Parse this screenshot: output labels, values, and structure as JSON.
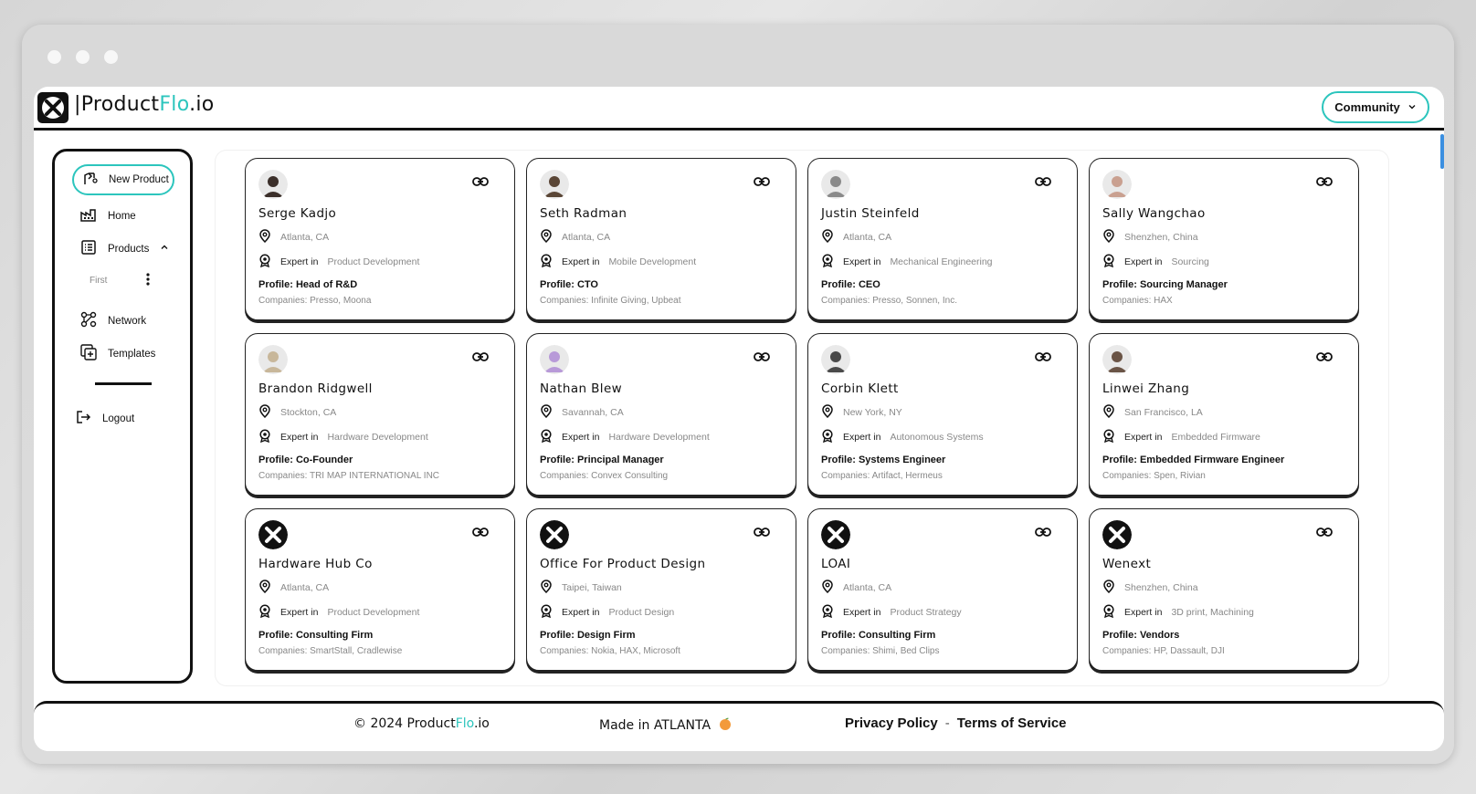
{
  "brand": {
    "prefix": "|Product",
    "accent": "Flo",
    "suffix": ".io"
  },
  "header": {
    "community_label": "Community"
  },
  "sidebar": {
    "new_product_label": "New Product",
    "items": [
      {
        "label": "Home",
        "icon": "factory-icon"
      },
      {
        "label": "Products",
        "icon": "list-icon"
      },
      {
        "label": "Network",
        "icon": "network-icon"
      },
      {
        "label": "Templates",
        "icon": "templates-icon"
      }
    ],
    "products_sub": "First",
    "logout_label": "Logout"
  },
  "cards": [
    {
      "name": "Serge Kadjo",
      "location": "Atlanta, CA",
      "expert_prefix": "Expert in",
      "expertise": "Product Development",
      "profile": "Profile: Head of R&D",
      "companies": "Companies: Presso, Moona",
      "avatar": "person",
      "avatar_color": "#3b2f2a"
    },
    {
      "name": "Seth Radman",
      "location": "Atlanta, CA",
      "expert_prefix": "Expert in",
      "expertise": "Mobile Development",
      "profile": "Profile: CTO",
      "companies": "Companies: Infinite Giving, Upbeat",
      "avatar": "person",
      "avatar_color": "#5a4636"
    },
    {
      "name": "Justin Steinfeld",
      "location": "Atlanta, CA",
      "expert_prefix": "Expert in",
      "expertise": "Mechanical Engineering",
      "profile": "Profile: CEO",
      "companies": "Companies: Presso, Sonnen, Inc.",
      "avatar": "person",
      "avatar_color": "#8a8a8a"
    },
    {
      "name": "Sally Wangchao",
      "location": "Shenzhen, China",
      "expert_prefix": "Expert in",
      "expertise": "Sourcing",
      "profile": "Profile: Sourcing Manager",
      "companies": "Companies: HAX",
      "avatar": "person",
      "avatar_color": "#c9a090"
    },
    {
      "name": "Brandon Ridgwell",
      "location": "Stockton, CA",
      "expert_prefix": "Expert in",
      "expertise": "Hardware Development",
      "profile": "Profile: Co-Founder",
      "companies": "Companies: TRI MAP INTERNATIONAL INC",
      "avatar": "person",
      "avatar_color": "#c8b79a"
    },
    {
      "name": "Nathan Blew",
      "location": "Savannah, CA",
      "expert_prefix": "Expert in",
      "expertise": "Hardware Development",
      "profile": "Profile: Principal Manager",
      "companies": "Companies: Convex Consulting",
      "avatar": "person",
      "avatar_color": "#b89ad8"
    },
    {
      "name": "Corbin Klett",
      "location": "New York, NY",
      "expert_prefix": "Expert in",
      "expertise": "Autonomous Systems",
      "profile": "Profile: Systems Engineer",
      "companies": "Companies: Artifact, Hermeus",
      "avatar": "person",
      "avatar_color": "#4a4a4a"
    },
    {
      "name": "Linwei Zhang",
      "location": "San Francisco, LA",
      "expert_prefix": "Expert in",
      "expertise": "Embedded Firmware",
      "profile": "Profile: Embedded Firmware Engineer",
      "companies": "Companies: Spen, Rivian",
      "avatar": "person",
      "avatar_color": "#6a5446"
    },
    {
      "name": "Hardware Hub Co",
      "location": "Atlanta, CA",
      "expert_prefix": "Expert in",
      "expertise": "Product Development",
      "profile": "Profile: Consulting Firm",
      "companies": "Companies: SmartStall, Cradlewise",
      "avatar": "logo",
      "avatar_color": "#111111"
    },
    {
      "name": "Office For Product Design",
      "location": "Taipei, Taiwan",
      "expert_prefix": "Expert in",
      "expertise": "Product Design",
      "profile": "Profile: Design Firm",
      "companies": "Companies: Nokia, HAX, Microsoft",
      "avatar": "logo",
      "avatar_color": "#111111"
    },
    {
      "name": "LOAI",
      "location": "Atlanta, CA",
      "expert_prefix": "Expert in",
      "expertise": "Product Strategy",
      "profile": "Profile: Consulting Firm",
      "companies": "Companies: Shimi, Bed Clips",
      "avatar": "logo",
      "avatar_color": "#111111"
    },
    {
      "name": "Wenext",
      "location": "Shenzhen, China",
      "expert_prefix": "Expert in",
      "expertise": "3D print, Machining",
      "profile": "Profile: Vendors",
      "companies": "Companies: HP, Dassault, DJI",
      "avatar": "logo",
      "avatar_color": "#111111"
    }
  ],
  "footer": {
    "copy_prefix": "© 2024 Product",
    "copy_accent": "Flo",
    "copy_suffix": ".io",
    "made_in": "Made in ATLANTA",
    "privacy": "Privacy Policy",
    "separator": "-",
    "terms": "Terms of Service"
  },
  "colors": {
    "accent": "#2cc5bd",
    "ink": "#111111",
    "muted": "#888888"
  }
}
